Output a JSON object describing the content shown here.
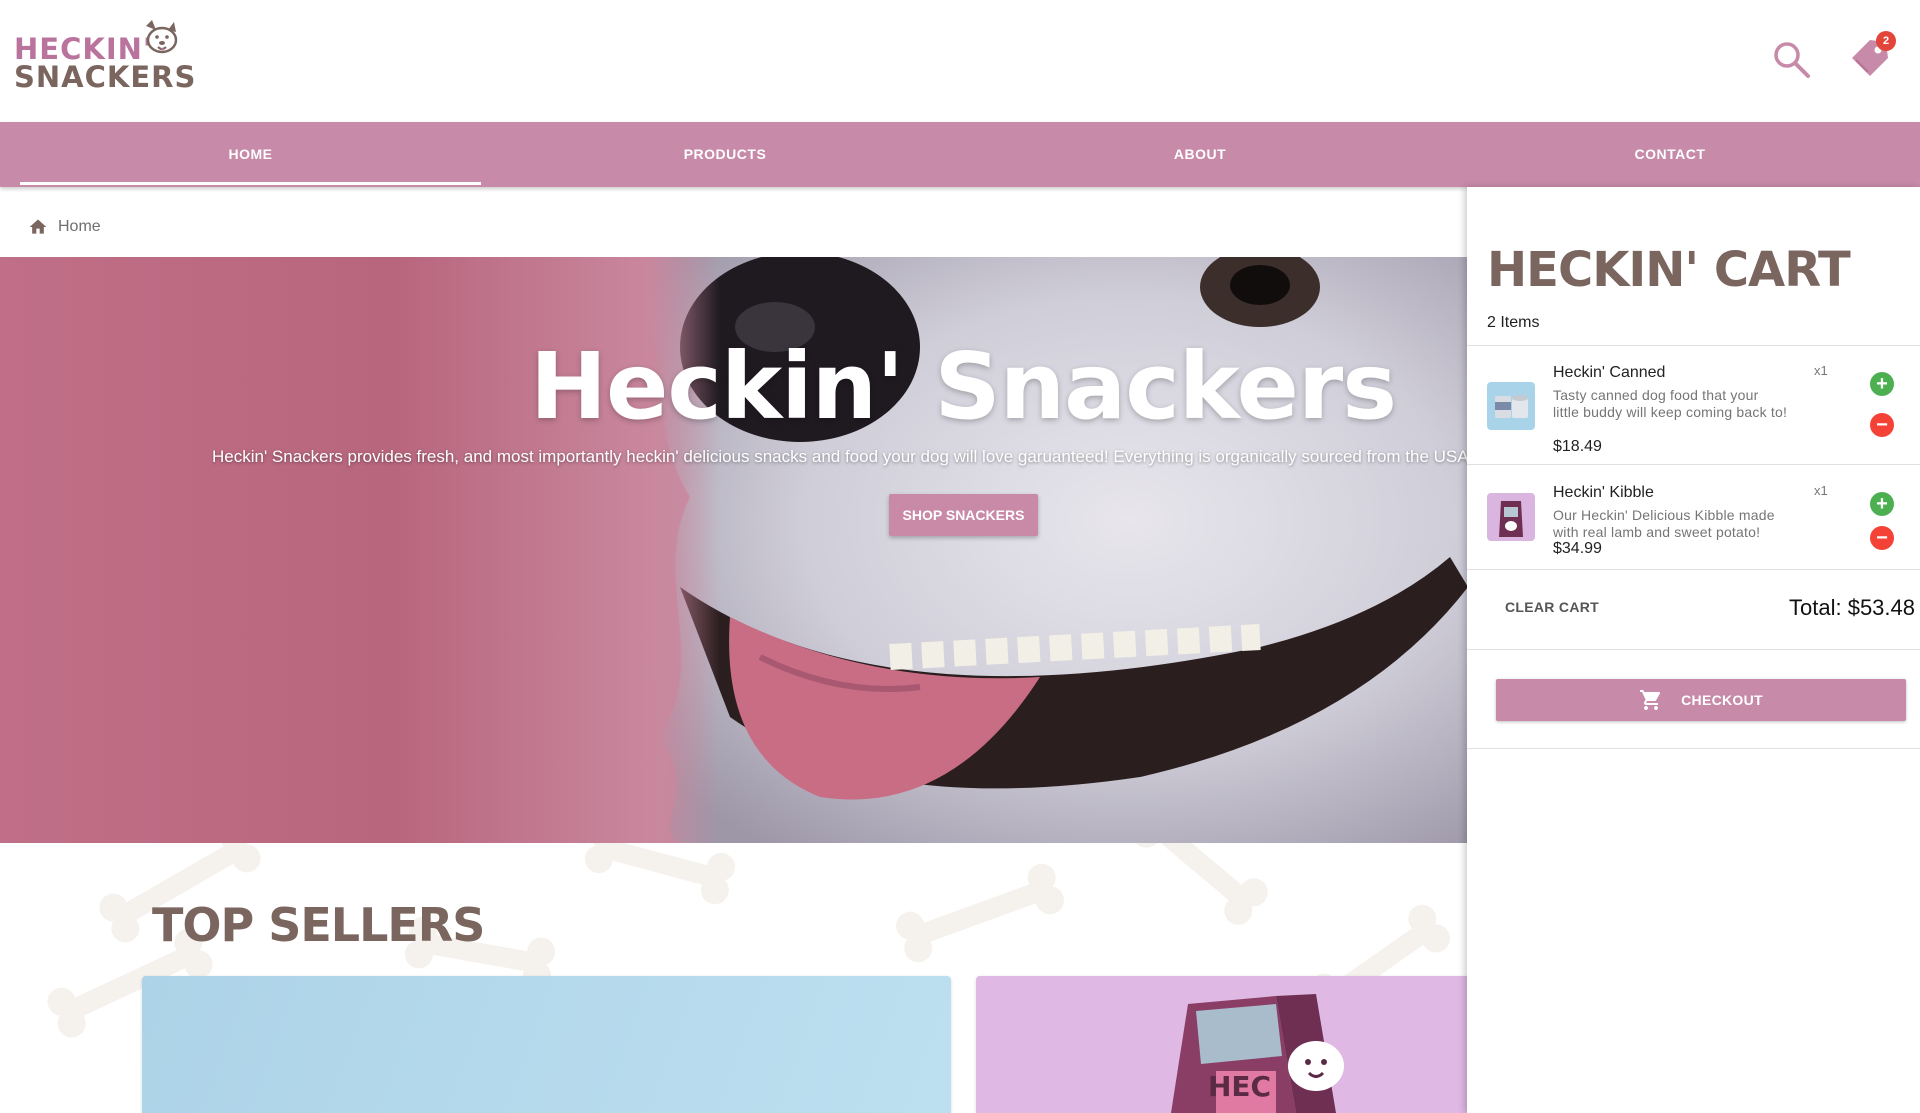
{
  "brand": {
    "logo_line1": "HECKIN'",
    "logo_line2": "SNACKERS",
    "primary_color": "#c78aa8",
    "brand_brown": "#7a655f"
  },
  "header": {
    "cart_count": "2"
  },
  "nav": {
    "items": [
      {
        "label": "HOME",
        "active": true
      },
      {
        "label": "PRODUCTS"
      },
      {
        "label": "ABOUT"
      },
      {
        "label": "CONTACT"
      }
    ]
  },
  "breadcrumb": {
    "label": "Home"
  },
  "hero": {
    "title": "Heckin' Snackers",
    "description": "Heckin' Snackers provides fresh, and most importantly heckin' delicious snacks and food your dog will love garuanteed! Everything is organically sourced from the USA and v",
    "button_label": "SHOP SNACKERS"
  },
  "top_sellers": {
    "title": "TOP SELLERS"
  },
  "cart": {
    "title": "HECKIN' CART",
    "count_label": "2 Items",
    "items": [
      {
        "name": "Heckin' Canned",
        "description": "Tasty canned dog food that your little buddy will keep coming back to!",
        "price": "$18.49",
        "qty": "x1"
      },
      {
        "name": "Heckin' Kibble",
        "description": "Our Heckin' Delicious Kibble made with real lamb and sweet potato!",
        "price": "$34.99",
        "qty": "x1"
      }
    ],
    "clear_label": "CLEAR CART",
    "total_label": "Total: $53.48",
    "checkout_label": "CHECKOUT"
  }
}
